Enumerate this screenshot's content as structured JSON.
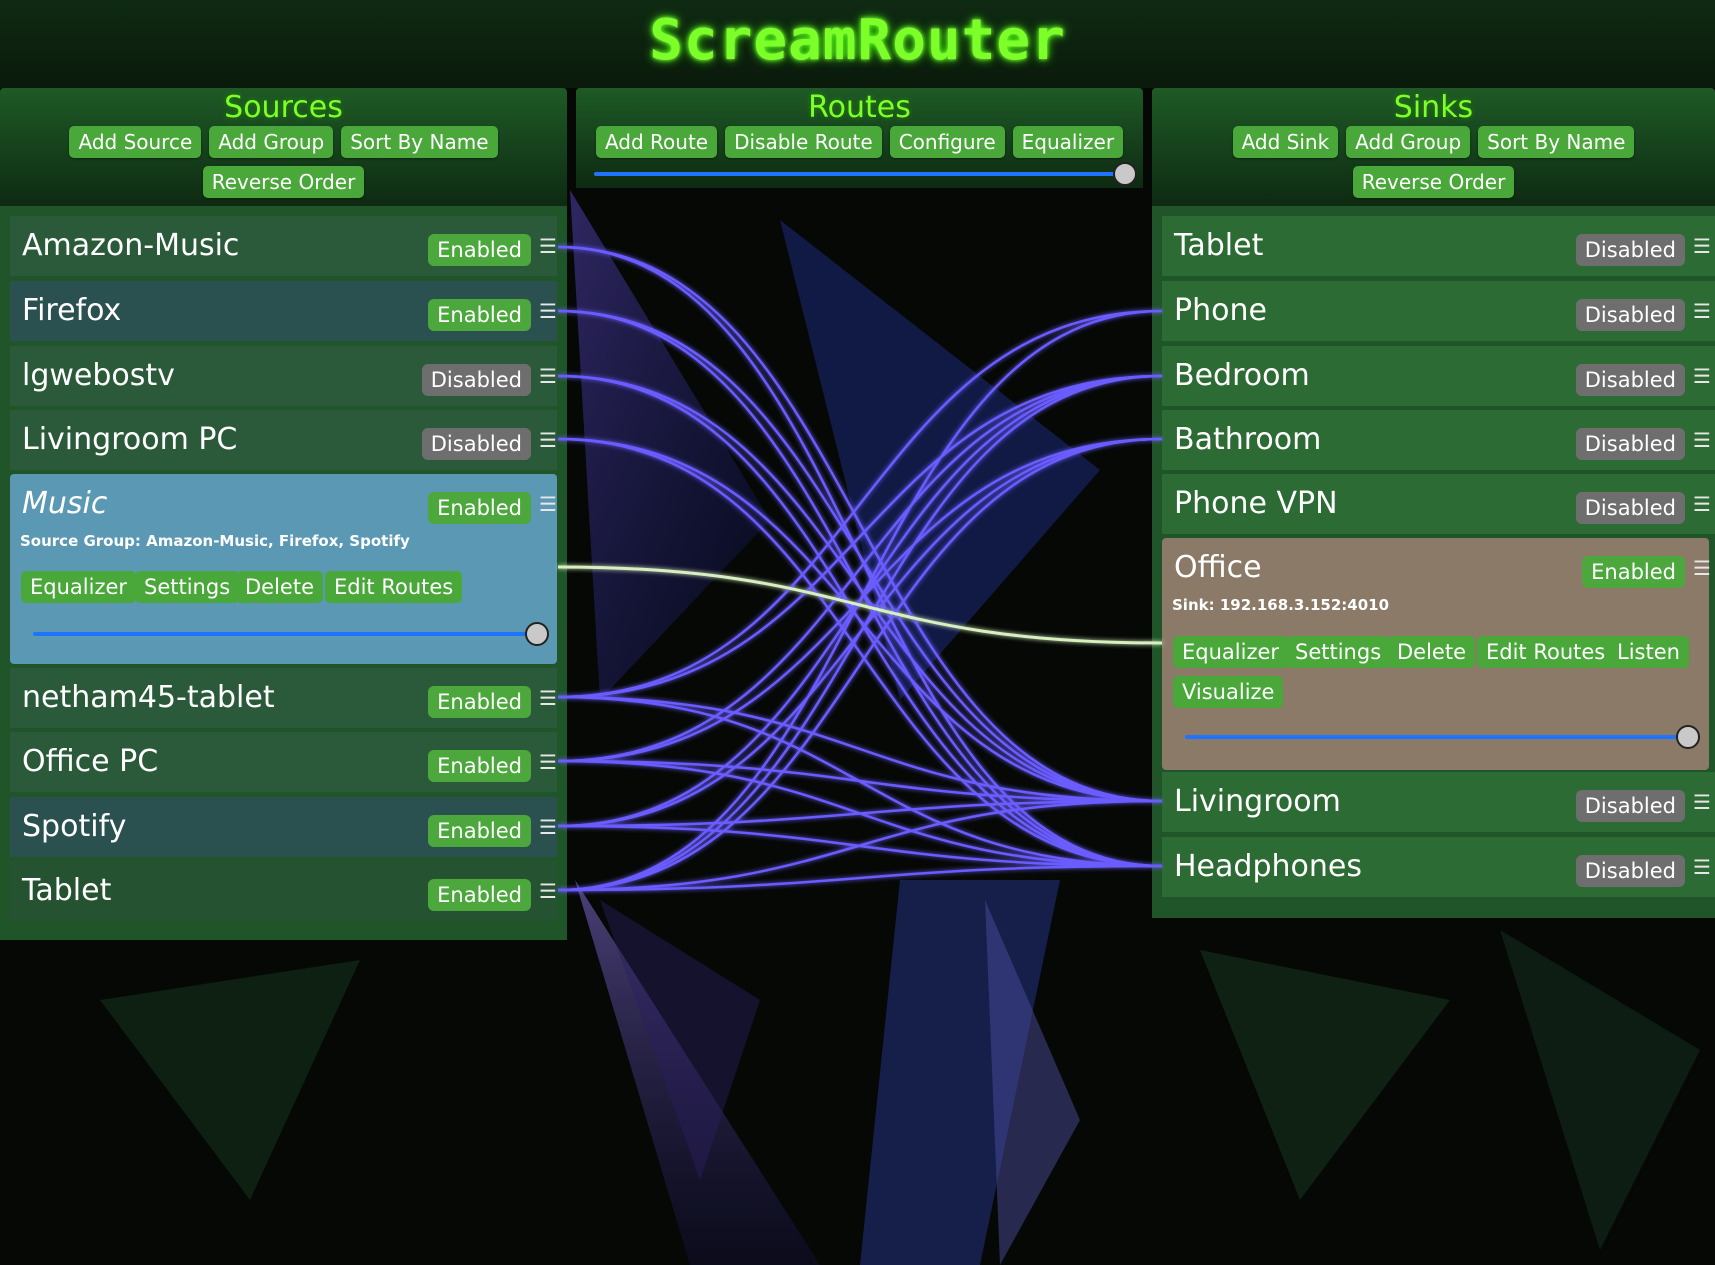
{
  "app": {
    "title": "ScreamRouter"
  },
  "sources": {
    "title": "Sources",
    "buttons": [
      "Add Source",
      "Add Group",
      "Sort By Name",
      "Reverse Order"
    ],
    "items": [
      {
        "name": "Amazon-Music",
        "status": "Enabled"
      },
      {
        "name": "Firefox",
        "status": "Enabled"
      },
      {
        "name": "lgwebostv",
        "status": "Disabled"
      },
      {
        "name": "Livingroom PC",
        "status": "Disabled"
      },
      {
        "name": "Music",
        "status": "Enabled",
        "meta": "Source Group: Amazon-Music, Firefox, Spotify",
        "actions": [
          "Equalizer",
          "Settings",
          "Delete",
          "Edit Routes"
        ],
        "volume": 1.0
      },
      {
        "name": "netham45-tablet",
        "status": "Enabled"
      },
      {
        "name": "Office PC",
        "status": "Enabled"
      },
      {
        "name": "Spotify",
        "status": "Enabled"
      },
      {
        "name": "Tablet",
        "status": "Enabled"
      }
    ]
  },
  "routes": {
    "title": "Routes",
    "buttons": [
      "Add Route",
      "Disable Route",
      "Configure",
      "Equalizer"
    ],
    "volume": 1.0
  },
  "sinks": {
    "title": "Sinks",
    "buttons": [
      "Add Sink",
      "Add Group",
      "Sort By Name",
      "Reverse Order"
    ],
    "items": [
      {
        "name": "Tablet",
        "status": "Disabled"
      },
      {
        "name": "Phone",
        "status": "Disabled"
      },
      {
        "name": "Bedroom",
        "status": "Disabled"
      },
      {
        "name": "Bathroom",
        "status": "Disabled"
      },
      {
        "name": "Phone VPN",
        "status": "Disabled"
      },
      {
        "name": "Office",
        "status": "Enabled",
        "meta": "Sink: 192.168.3.152:4010",
        "actions": [
          "Equalizer",
          "Settings",
          "Delete",
          "Edit Routes",
          "Listen",
          "Visualize"
        ],
        "volume": 1.0
      },
      {
        "name": "Livingroom",
        "status": "Disabled"
      },
      {
        "name": "Headphones",
        "status": "Disabled"
      }
    ]
  },
  "colors": {
    "accent": "#7dff2a",
    "button": "#4aa83a",
    "disabled": "#6e6e6e",
    "wire": "#6a5cff",
    "selected_wire": "#d8f0c0"
  }
}
